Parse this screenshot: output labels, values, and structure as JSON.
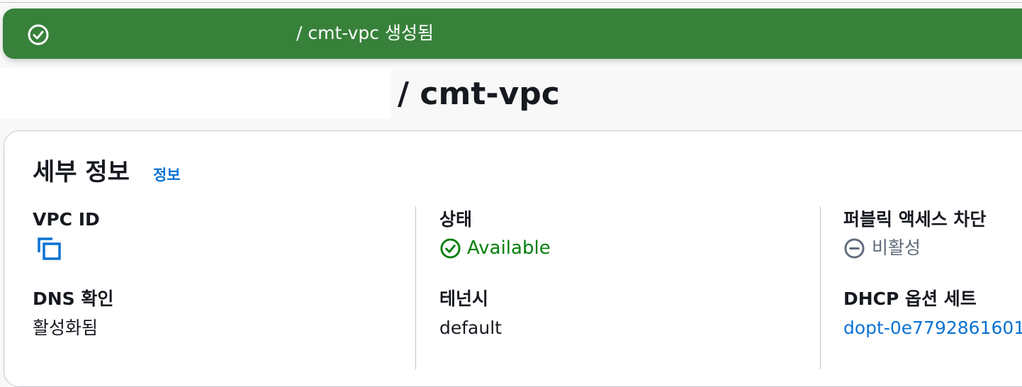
{
  "banner": {
    "message": "/ cmt-vpc 생성됨"
  },
  "page": {
    "title": "/ cmt-vpc"
  },
  "details": {
    "title": "세부 정보",
    "info_link": "정보",
    "vpc_id": {
      "label": "VPC ID",
      "value": ""
    },
    "state": {
      "label": "상태",
      "value": "Available"
    },
    "block_public_access": {
      "label": "퍼블릭 액세스 차단",
      "value": "비활성"
    },
    "dns_resolution": {
      "label": "DNS 확인",
      "value": "활성화됨"
    },
    "tenancy": {
      "label": "테넌시",
      "value": "default"
    },
    "dhcp_option_set": {
      "label": "DHCP 옵션 세트",
      "value": "dopt-0e7792861601"
    }
  },
  "colors": {
    "success_banner": "#37813a",
    "link": "#0972d3",
    "status_available": "#037f0c",
    "status_disabled": "#5f6b7a"
  },
  "icons": {
    "banner": "check-circle-icon",
    "copy": "copy-icon",
    "status": "check-circle-icon",
    "block": "minus-circle-icon"
  }
}
